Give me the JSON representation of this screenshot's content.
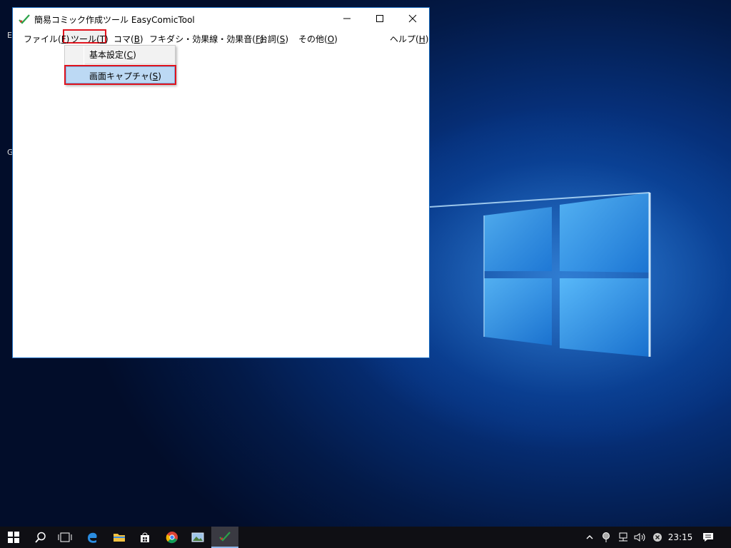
{
  "window": {
    "title": "簡易コミック作成ツール EasyComicTool"
  },
  "menu": [
    {
      "label": "ファイル(",
      "acc": "F",
      "tail": ")"
    },
    {
      "label": "ツール(",
      "acc": "T",
      "tail": ")"
    },
    {
      "label": "コマ(",
      "acc": "B",
      "tail": ")"
    },
    {
      "label": "フキダシ・効果線・効果音(",
      "acc": "F",
      "tail": ")"
    },
    {
      "label": "台詞(",
      "acc": "S",
      "tail": ")"
    },
    {
      "label": "その他(",
      "acc": "O",
      "tail": ")"
    },
    {
      "label": "ヘルプ(",
      "acc": "H",
      "tail": ")"
    }
  ],
  "dropdown": {
    "items": [
      {
        "label": "基本設定(",
        "acc": "C",
        "tail": ")"
      },
      {
        "label": "画面キャプチャ(",
        "acc": "S",
        "tail": ")"
      }
    ]
  },
  "desktop": {
    "fragments": [
      "E",
      "G"
    ]
  },
  "taskbar": {
    "clock": "23:15"
  },
  "colors": {
    "highlight_box": "#e0141e",
    "menu_hover": "#bcd9f4"
  }
}
